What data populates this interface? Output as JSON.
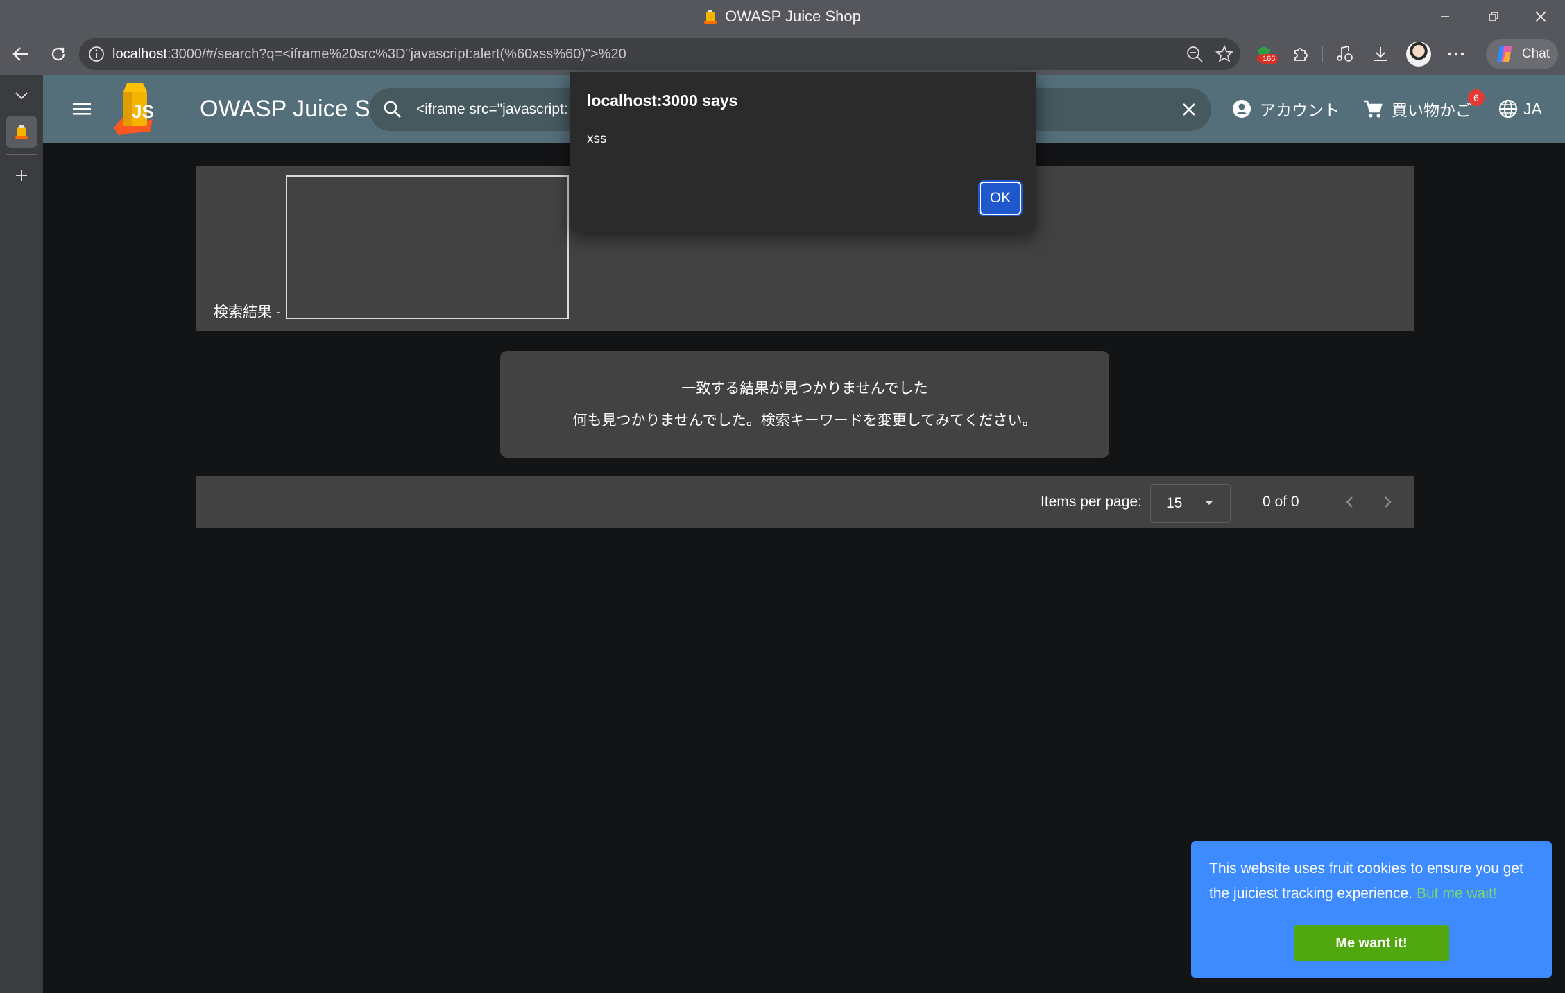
{
  "browser": {
    "window_title": "OWASP Juice Shop",
    "url_host": "localhost",
    "url_rest": ":3000/#/search?q=<iframe%20src%3D\"javascript:alert(%60xss%60)\">%20",
    "extension_badge": "166",
    "chat_label": "Chat"
  },
  "app": {
    "title": "OWASP Juice Shop",
    "search_value": "<iframe src=\"javascript:",
    "account_label": "アカウント",
    "basket_label": "買い物かご",
    "basket_count": "6",
    "language_label": "JA"
  },
  "results": {
    "label": "検索結果 -",
    "no_result_title": "一致する結果が見つかりませんでした",
    "no_result_hint": "何も見つかりませんでした。検索キーワードを変更してみてください。"
  },
  "paginator": {
    "items_per_page_label": "Items per page:",
    "page_size": "15",
    "range_label": "0 of 0"
  },
  "dialog": {
    "title": "localhost:3000 says",
    "message": "xss",
    "ok_label": "OK"
  },
  "cookie": {
    "message": "This website uses fruit cookies to ensure you get the juiciest tracking experience.",
    "link_text": "But me wait!",
    "button_label": "Me want it!"
  },
  "colors": {
    "app_header": "#546e7a",
    "card": "#424242",
    "cookie_banner": "#3d8bff",
    "cookie_button": "#51a80e",
    "dialog_ok": "#1f57cc",
    "badge": "#e53935"
  }
}
